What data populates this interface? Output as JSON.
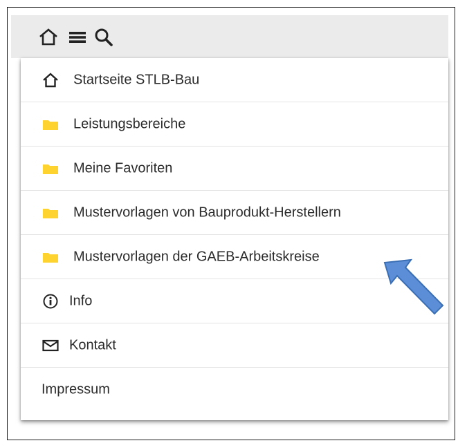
{
  "toolbar": {
    "icons": [
      "home-icon",
      "menu-icon",
      "search-icon"
    ],
    "background": "#ebebeb"
  },
  "menu": {
    "items": [
      {
        "label": "Startseite STLB-Bau",
        "icon": "home-icon"
      },
      {
        "label": "Leistungsbereiche",
        "icon": "folder-icon"
      },
      {
        "label": "Meine Favoriten",
        "icon": "folder-icon"
      },
      {
        "label": "Mustervorlagen von Bauprodukt-Herstellern",
        "icon": "folder-icon"
      },
      {
        "label": "Mustervorlagen der GAEB-Arbeitskreise",
        "icon": "folder-icon"
      },
      {
        "label": "Info",
        "icon": "info-icon"
      },
      {
        "label": "Kontakt",
        "icon": "mail-icon"
      },
      {
        "label": "Impressum",
        "icon": ""
      }
    ]
  },
  "colors": {
    "folder": "#fed330",
    "arrow_fill": "#5b8ed6",
    "arrow_stroke": "#3a6fb5",
    "text": "#2b2b2b"
  }
}
